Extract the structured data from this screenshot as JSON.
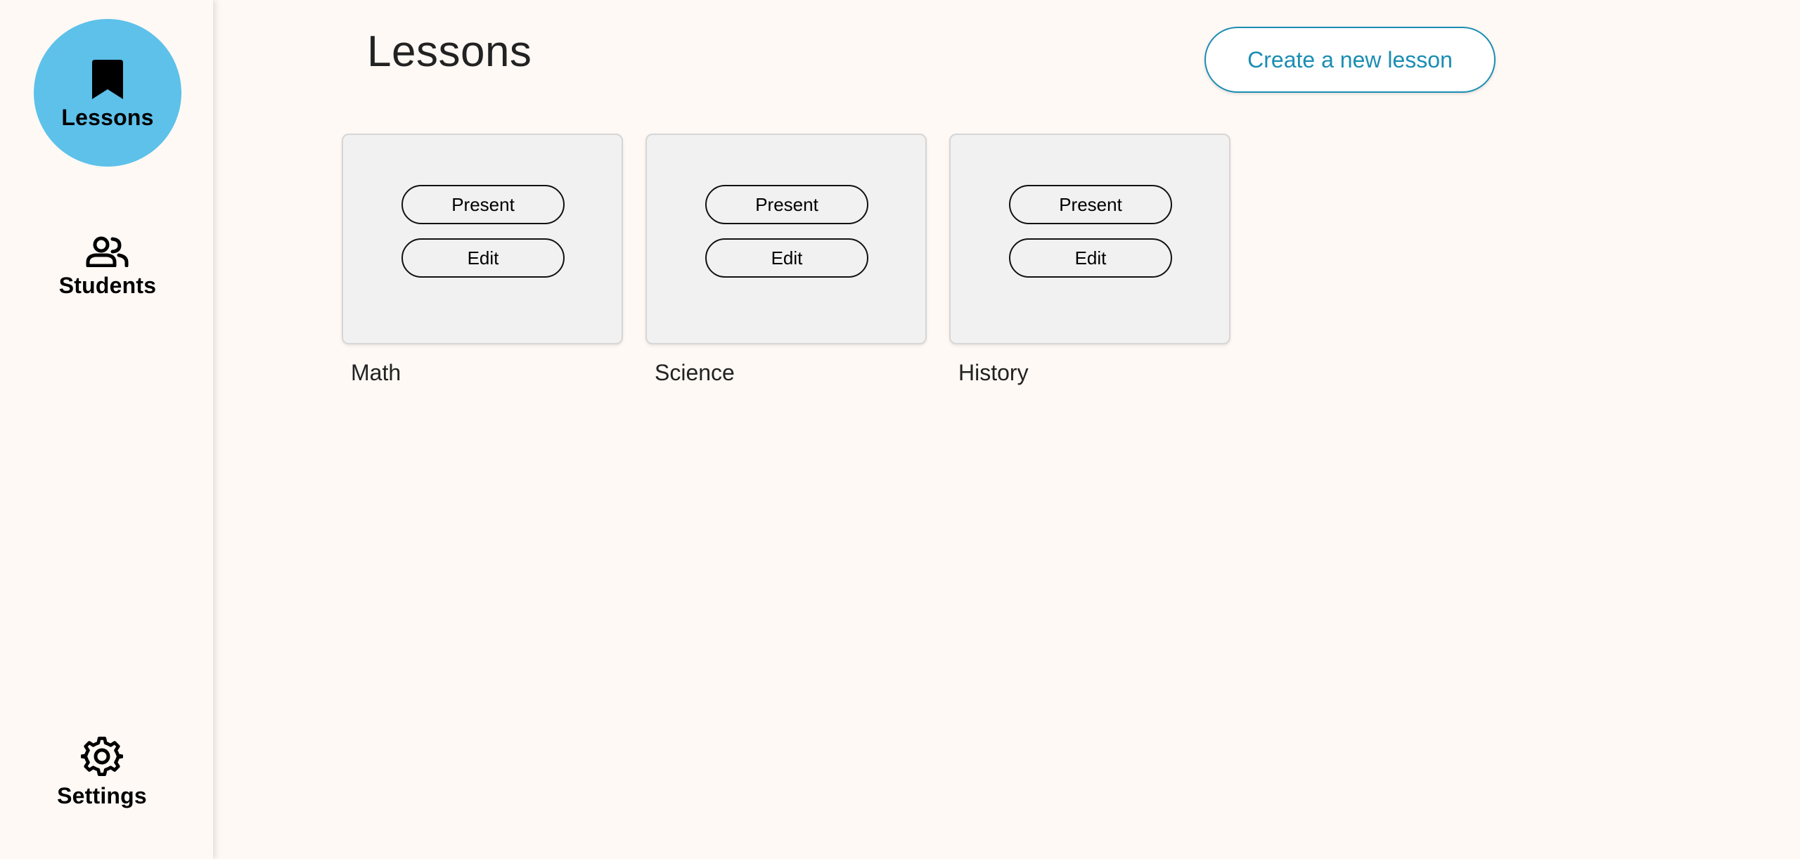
{
  "sidebar": {
    "items": [
      {
        "label": "Lessons",
        "icon": "bookmark-icon",
        "active": true
      },
      {
        "label": "Students",
        "icon": "people-icon",
        "active": false
      },
      {
        "label": "Settings",
        "icon": "gear-icon",
        "active": false
      }
    ]
  },
  "header": {
    "title": "Lessons",
    "create_button_label": "Create a new lesson"
  },
  "lessons": [
    {
      "name": "Math",
      "present_label": "Present",
      "edit_label": "Edit"
    },
    {
      "name": "Science",
      "present_label": "Present",
      "edit_label": "Edit"
    },
    {
      "name": "History",
      "present_label": "Present",
      "edit_label": "Edit"
    }
  ],
  "colors": {
    "background": "#fff9f5",
    "active_nav": "#5dc1ea",
    "accent": "#1b8db3",
    "card": "#f1f1f1"
  }
}
